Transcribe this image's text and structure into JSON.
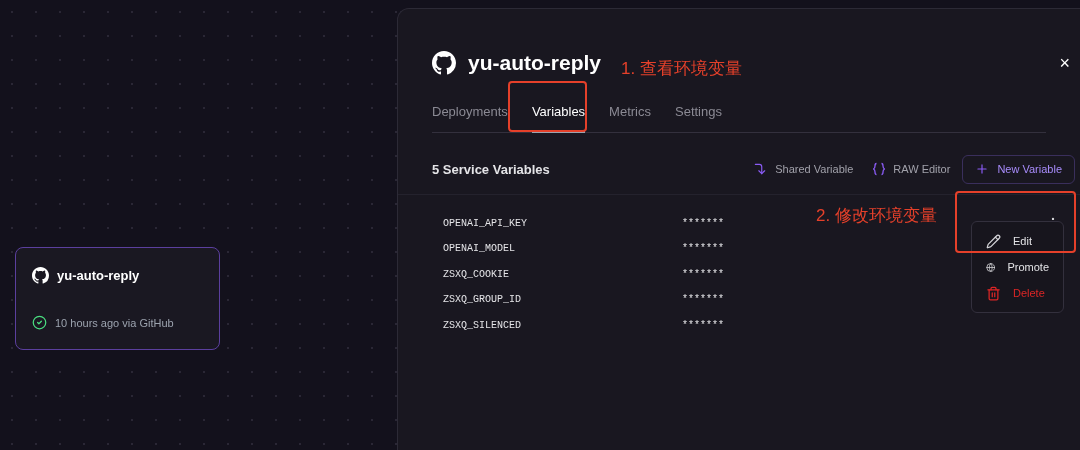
{
  "service_card": {
    "title": "yu-auto-reply",
    "status": "10 hours ago via GitHub"
  },
  "panel": {
    "title": "yu-auto-reply",
    "close": "×",
    "tabs": [
      {
        "label": "Deployments",
        "selected": false
      },
      {
        "label": "Variables",
        "selected": true
      },
      {
        "label": "Metrics",
        "selected": false
      },
      {
        "label": "Settings",
        "selected": false
      }
    ],
    "section_title": "5 Service Variables",
    "actions": [
      {
        "kind": "shared",
        "label": "Shared Variable"
      },
      {
        "kind": "raw",
        "label": "RAW Editor"
      },
      {
        "kind": "new",
        "label": "New Variable"
      }
    ],
    "variables": [
      {
        "name": "OPENAI_API_KEY",
        "value": "*******"
      },
      {
        "name": "OPENAI_MODEL",
        "value": "*******"
      },
      {
        "name": "ZSXQ_COOKIE",
        "value": "*******"
      },
      {
        "name": "ZSXQ_GROUP_ID",
        "value": "*******"
      },
      {
        "name": "ZSXQ_SILENCED",
        "value": "*******"
      }
    ],
    "row_menu": [
      {
        "kind": "edit",
        "label": "Edit"
      },
      {
        "kind": "promote",
        "label": "Promote"
      },
      {
        "kind": "delete",
        "label": "Delete"
      }
    ]
  },
  "annotations": [
    "1. 查看环境变量",
    "2. 修改环境变量"
  ]
}
